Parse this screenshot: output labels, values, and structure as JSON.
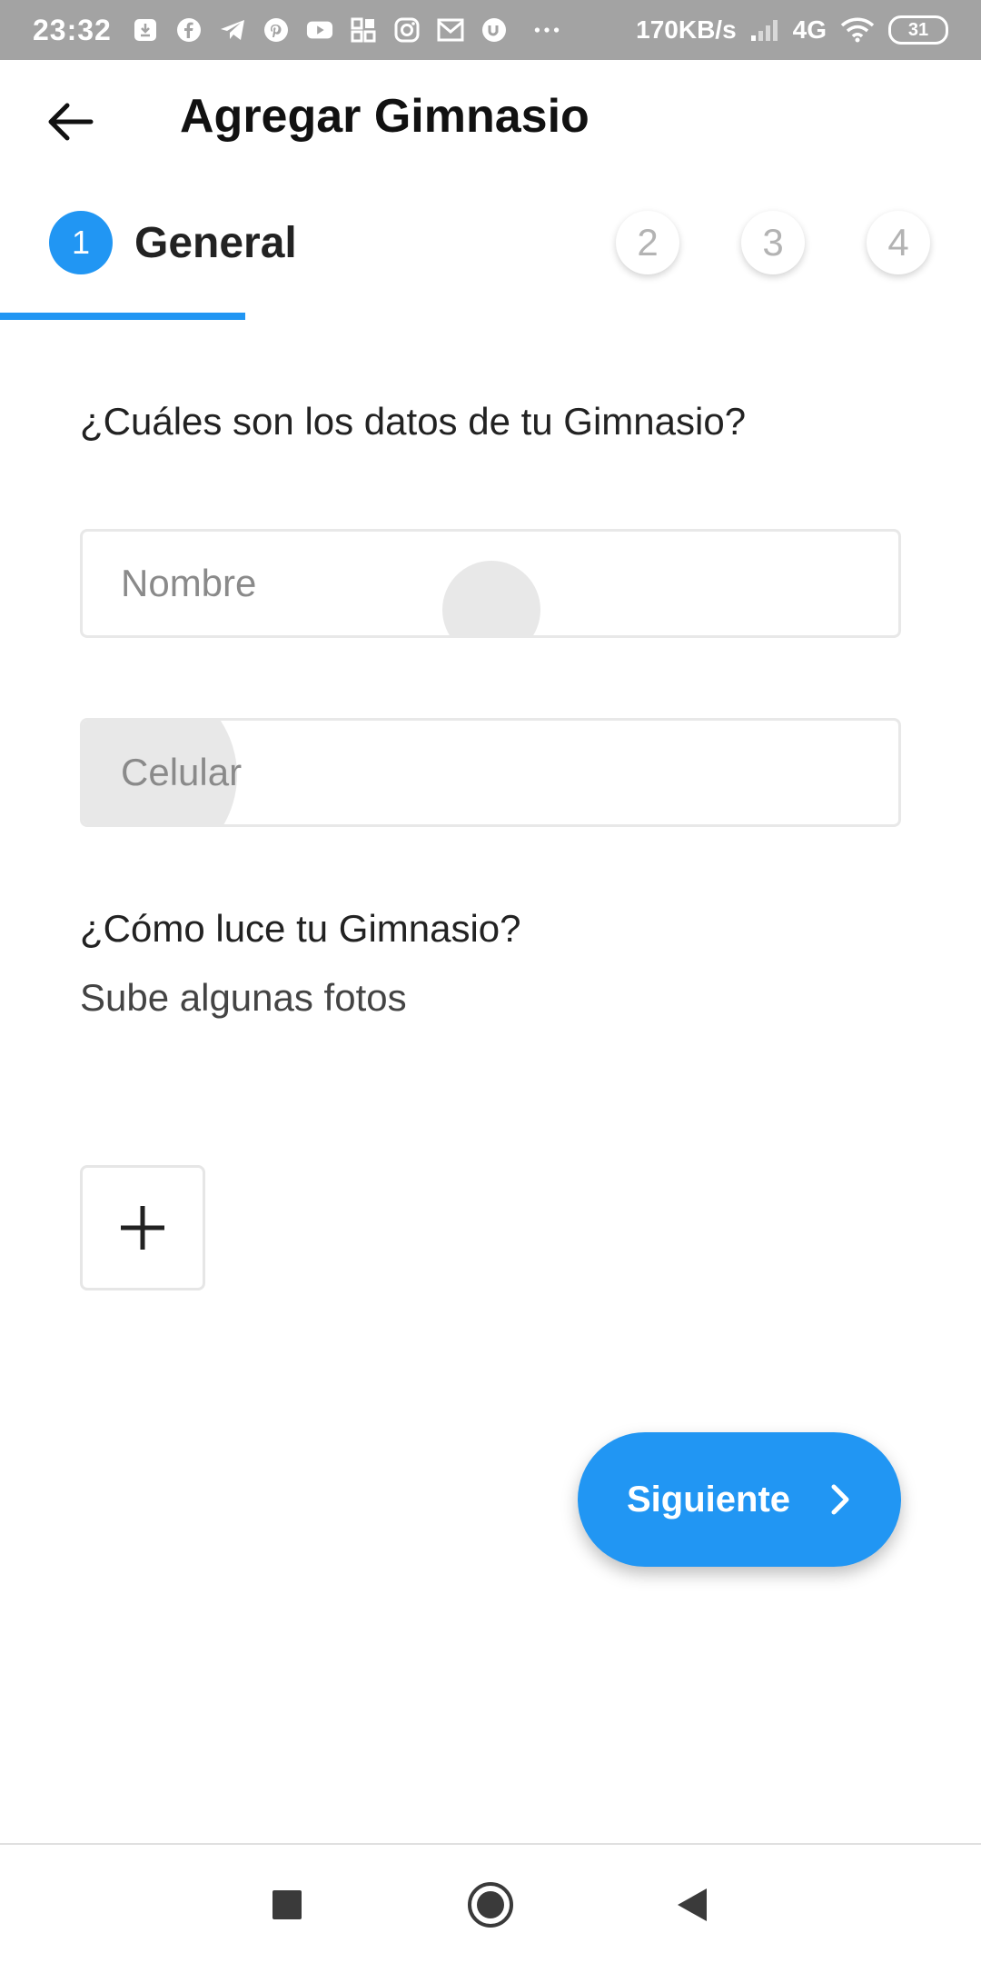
{
  "status_bar": {
    "time": "23:32",
    "network_speed": "170KB/s",
    "network_type": "4G",
    "battery": "31",
    "icons": [
      "download-icon",
      "facebook-icon",
      "telegram-icon",
      "pinterest-icon",
      "youtube-icon",
      "apps-icon",
      "instagram-icon",
      "mail-icon",
      "app-u-icon",
      "more-dots-icon"
    ]
  },
  "app_bar": {
    "title": "Agregar Gimnasio",
    "back_icon": "arrow-left-icon"
  },
  "stepper": {
    "active_step": "1",
    "active_label": "General",
    "steps": [
      "2",
      "3",
      "4"
    ]
  },
  "form": {
    "question": "¿Cuáles son los datos de tu Gimnasio?",
    "name_placeholder": "Nombre",
    "phone_placeholder": "Celular",
    "photos_title": "¿Cómo luce tu Gimnasio?",
    "photos_subtitle": "Sube algunas fotos"
  },
  "actions": {
    "next_label": "Siguiente"
  },
  "colors": {
    "accent": "#2196f3",
    "status_bar": "#a3a3a3"
  }
}
